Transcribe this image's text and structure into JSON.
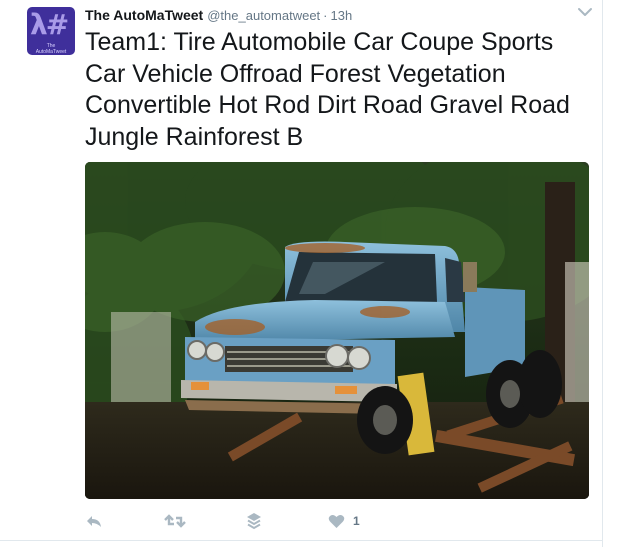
{
  "tweet": {
    "author": {
      "name": "The AutoMaTweet",
      "handle": "@the_automatweet",
      "avatar_glyph": "λ#",
      "avatar_caption": "The AutoMaTweet"
    },
    "separator": "·",
    "time": "13h",
    "text": "Team1: Tire Automobile Car Coupe Sports Car Vehicle Offroad Forest Vegetation Convertible Hot Rod Dirt Road Gravel Road Jungle Rainforest B",
    "media": {
      "icon": "photo",
      "colors": {
        "truck_blue": "#6aa0c4",
        "foliage": "#1e3a17",
        "rust": "#9a5a2a"
      }
    },
    "actions": {
      "reply": {
        "icon": "reply-icon"
      },
      "retweet": {
        "icon": "retweet-icon"
      },
      "buffer": {
        "icon": "stack-icon"
      },
      "like": {
        "icon": "heart-icon",
        "count": "1"
      }
    },
    "menu": {
      "icon": "chevron-down-icon"
    }
  },
  "colors": {
    "secondary_text": "#657786",
    "icon": "#aab8c2",
    "border": "#e1e8ed"
  }
}
